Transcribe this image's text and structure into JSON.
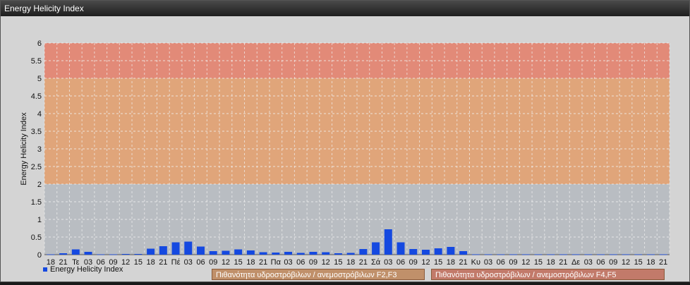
{
  "window": {
    "title": "Energy Helicity Index"
  },
  "badges": {
    "f23": "Πιθανότητα υδροστρόβιλων / ανεμοστρόβιλων F2,F3",
    "f45": "Πιθανότητα υδροστρόβιλων / ανεμοστρόβιλων F4,F5"
  },
  "colors": {
    "bar": "#1549e0",
    "zone_low": "#b9bdc2",
    "zone_mid": "#e0a57a",
    "zone_high": "#e28a78",
    "grid": "#f2f2f2"
  },
  "chart_data": {
    "type": "bar",
    "ylabel": "Energy Helicity Index",
    "ylim": [
      0,
      6
    ],
    "yticks": [
      "0",
      "0.5",
      "1",
      "1.5",
      "2",
      "2.5",
      "3",
      "3.5",
      "4",
      "4.5",
      "5",
      "5.5",
      "6"
    ],
    "zones": [
      {
        "from": 0,
        "to": 2,
        "color": "#b9bdc2"
      },
      {
        "from": 2,
        "to": 5,
        "color": "#e0a57a"
      },
      {
        "from": 5,
        "to": 6,
        "color": "#e28a78"
      }
    ],
    "categories": [
      "18",
      "21",
      "Τε",
      "03",
      "06",
      "09",
      "12",
      "15",
      "18",
      "21",
      "Πέ",
      "03",
      "06",
      "09",
      "12",
      "15",
      "18",
      "21",
      "Πα",
      "03",
      "06",
      "09",
      "12",
      "15",
      "18",
      "21",
      "Σά",
      "03",
      "06",
      "09",
      "12",
      "15",
      "18",
      "21",
      "Κυ",
      "03",
      "06",
      "09",
      "12",
      "15",
      "18",
      "21",
      "Δε",
      "03",
      "06",
      "09",
      "12",
      "15",
      "18",
      "21"
    ],
    "series": [
      {
        "name": "Energy Helicity Index",
        "values": [
          0.01,
          0.04,
          0.15,
          0.08,
          0.01,
          0.01,
          0.02,
          0.02,
          0.17,
          0.24,
          0.35,
          0.37,
          0.23,
          0.1,
          0.11,
          0.15,
          0.12,
          0.07,
          0.06,
          0.08,
          0.05,
          0.08,
          0.07,
          0.04,
          0.05,
          0.16,
          0.35,
          0.72,
          0.35,
          0.16,
          0.14,
          0.18,
          0.22,
          0.1,
          0.01,
          0.01,
          0.01,
          0.01,
          0.01,
          0.01,
          0.01,
          0.01,
          0.01,
          0.01,
          0.01,
          0.01,
          0.01,
          0.01,
          0.01,
          0.01
        ]
      }
    ],
    "legend": "bottom-left",
    "grid": true
  }
}
